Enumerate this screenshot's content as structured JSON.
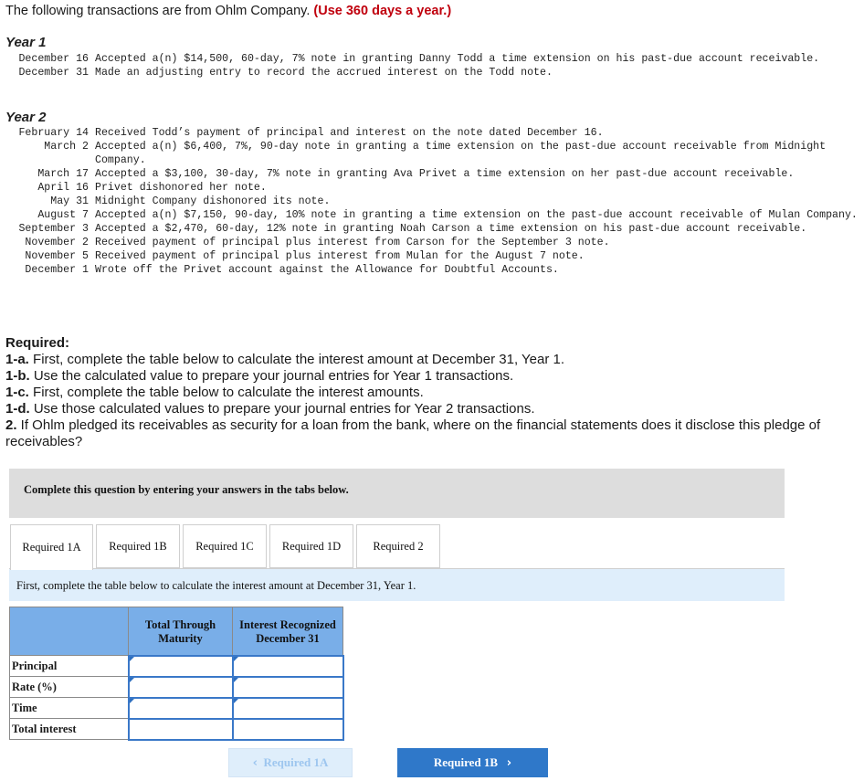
{
  "intro": {
    "text": "The following transactions are from Ohlm Company. ",
    "emphasis": "(Use 360 days a year.)"
  },
  "year1": {
    "heading": "Year 1",
    "transactions": [
      {
        "date": "December 16",
        "text": "Accepted a(n) $14,500, 60-day, 7% note in granting Danny Todd a time extension on his past-due account receivable."
      },
      {
        "date": "December 31",
        "text": "Made an adjusting entry to record the accrued interest on the Todd note."
      }
    ]
  },
  "year2": {
    "heading": "Year 2",
    "transactions": [
      {
        "date": "February 14",
        "text": "Received Todd’s payment of principal and interest on the note dated December 16."
      },
      {
        "date": "March 2",
        "text": "Accepted a(n) $6,400, 7%, 90-day note in granting a time extension on the past-due account receivable from Midnight Company."
      },
      {
        "date": "March 17",
        "text": "Accepted a $3,100, 30-day, 7% note in granting Ava Privet a time extension on her past-due account receivable."
      },
      {
        "date": "April 16",
        "text": "Privet dishonored her note."
      },
      {
        "date": "May 31",
        "text": "Midnight Company dishonored its note."
      },
      {
        "date": "August 7",
        "text": "Accepted a(n) $7,150, 90-day, 10% note in granting a time extension on the past-due account receivable of Mulan Company."
      },
      {
        "date": "September 3",
        "text": "Accepted a $2,470, 60-day, 12% note in granting Noah Carson a time extension on his past-due account receivable."
      },
      {
        "date": "November 2",
        "text": "Received payment of principal plus interest from Carson for the September 3 note."
      },
      {
        "date": "November 5",
        "text": "Received payment of principal plus interest from Mulan for the August 7 note."
      },
      {
        "date": "December 1",
        "text": "Wrote off the Privet account against the Allowance for Doubtful Accounts."
      }
    ]
  },
  "required": {
    "title": "Required:",
    "items": [
      {
        "num": "1-a.",
        "text": " First, complete the table below to calculate the interest amount at December 31, Year 1."
      },
      {
        "num": "1-b.",
        "text": " Use the calculated value to prepare your journal entries for Year 1 transactions."
      },
      {
        "num": "1-c.",
        "text": " First, complete the table below to calculate the interest amounts."
      },
      {
        "num": "1-d.",
        "text": " Use those calculated values to prepare your journal entries for Year 2 transactions."
      },
      {
        "num": "2.",
        "text": " If Ohlm pledged its receivables as security for a loan from the bank, where on the financial statements does it disclose this pledge of receivables?"
      }
    ]
  },
  "banner": "Complete this question by entering your answers in the tabs below.",
  "tabs": [
    "Required 1A",
    "Required 1B",
    "Required 1C",
    "Required 1D",
    "Required 2"
  ],
  "active_tab": "Required 1A",
  "instruction": "First, complete the table below to calculate the interest amount at December 31, Year 1.",
  "table": {
    "headers": [
      "Total Through Maturity",
      "Interest Recognized December 31"
    ],
    "rows": [
      "Principal",
      "Rate (%)",
      "Time",
      "Total interest"
    ]
  },
  "nav": {
    "prev": "Required 1A",
    "next": "Required 1B"
  },
  "colors": {
    "emphasis": "#c0000d",
    "header_fill": "#79aee8",
    "next_button": "#2f78c9",
    "instruction_bg": "#dfeefb"
  }
}
